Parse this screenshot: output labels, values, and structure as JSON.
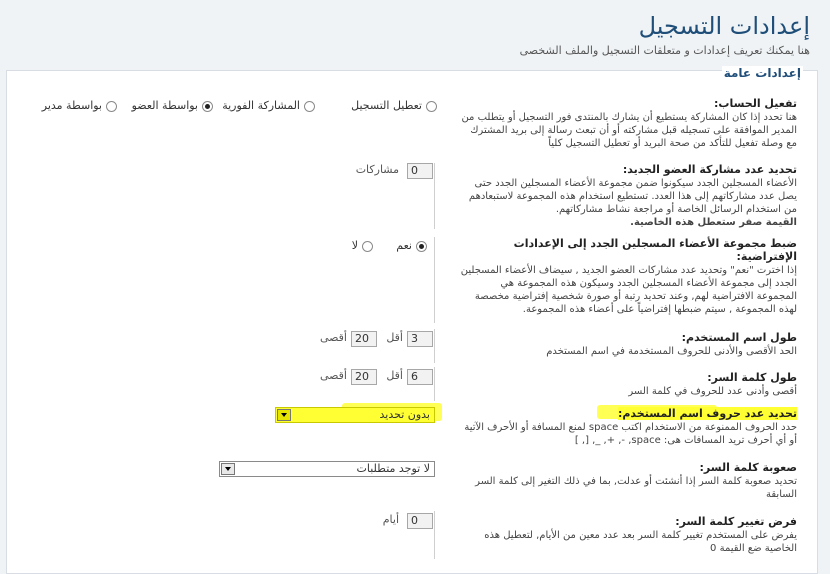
{
  "header": {
    "title": "إعدادات التسجيل",
    "subtitle": "هنا يمكنك تعريف إعدادات و متعلقات التسجيل والملف الشخصى"
  },
  "panel": {
    "legend": "إعدادات عامة"
  },
  "activation": {
    "title": "تفعيل الحساب:",
    "desc": "هنا تحدد إذا كان المشاركة يستطيع أن يشارك بالمنتدى فور التسجيل أو يتطلب من المدير الموافقة على تسجيله قبل مشاركته أو أن تبعث رسالة إلى بريد المشترك مع وصلة تفعيل للتأكد من صحة البريد أو تعطيل التسجيل كلياً",
    "options": [
      "تعطيل التسجيل",
      "المشاركة الفورية",
      "بواسطة العضو",
      "بواسطة مدير"
    ],
    "selected": "بواسطة العضو"
  },
  "new_posts": {
    "title": "تحديد عدد مشاركة العضو الجديد:",
    "desc": "الأعضاء المسجلين الجدد سيكونوا ضمن مجموعة الأعضاء المسجلين الجدد حتى يصل عدد مشاركاتهم إلى هذا العدد. تستطيع استخدام هذه المجموعة لاستبعادهم من استخدام الرسائل الخاصة أو مراجعة نشاط مشاركاتهم.",
    "note": "القيمة صفر ستعطل هذه الخاصية.",
    "value": "0",
    "unit": "مشاركات"
  },
  "default_group": {
    "title": "ضبط مجموعة الأعضاء المسجلين الجدد إلى الإعدادات الإفتراضية:",
    "desc": "إذا اخترت \"نعم\" وتحديد عدد مشاركات العضو الجديد , سيضاف الأعضاء المسجلين الجدد إلى مجموعة الأعضاء المسجلين الجدد وسيكون هذه المجموعة هي المجموعة الافتراضية لهم, وعند تحديد رتبة أو صورة شخصية إفتراضية مخصصة لهذه المجموعة , سيتم ضبطها إفتراضياً على أعضاء هذه المجموعة.",
    "yes": "نعم",
    "no": "لا",
    "selected": "نعم"
  },
  "username_len": {
    "title": "طول اسم المستخدم:",
    "desc": "الحد الأقصى والأدنى للحروف المستخدمة في اسم المستخدم",
    "min": "3",
    "min_label": "أقل",
    "max": "20",
    "max_label": "أقصى"
  },
  "password_len": {
    "title": "طول كلمة السر:",
    "desc": "أقصى وأدنى عدد للحروف في كلمة السر",
    "min": "6",
    "min_label": "أقل",
    "max": "20",
    "max_label": "أقصى"
  },
  "username_chars": {
    "title": "تحديد عدد حروف اسم المستخدم:",
    "desc": "حدد الحروف الممنوعة من الاستخدام اكتب space لمنع المسافة أو الأحرف الآتية أو أي أحرف تريد المسافات هى: space, -, +, _, [, ]",
    "value": "بدون تحديد",
    "highlight": "#ffff33"
  },
  "password_complexity": {
    "title": "صعوبة كلمة السر:",
    "desc": "تحديد صعوبة كلمة السر إذا أنشئت أو عدلت, بما في ذلك التغير إلى كلمة السر السابقة",
    "value": "لا توجد متطلبات"
  },
  "force_change": {
    "title": "فرض تغيير كلمة السر:",
    "desc": "يفرض على المستخدم تغيير كلمة السر بعد عدد معين من الأيام, لتعطيل هذه الخاصية ضع القيمة 0",
    "value": "0",
    "unit": "أيام"
  }
}
